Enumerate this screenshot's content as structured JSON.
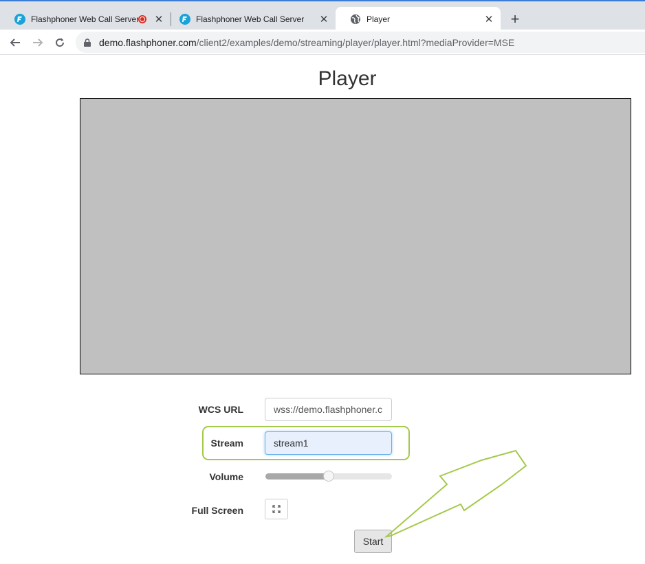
{
  "browser": {
    "tabs": [
      {
        "label": "Flashphoner Web Call Server",
        "favicon": "flashphoner-icon",
        "recording": true
      },
      {
        "label": "Flashphoner Web Call Server",
        "favicon": "flashphoner-icon"
      },
      {
        "label": "Player",
        "favicon": "globe-icon",
        "active": true
      }
    ],
    "new_tab": "+",
    "address": {
      "host": "demo.flashphoner.com",
      "path": "/client2/examples/demo/streaming/player/player.html?mediaProvider=MSE"
    }
  },
  "page": {
    "title": "Player",
    "form": {
      "wcs_url_label": "WCS URL",
      "wcs_url_value": "wss://demo.flashphoner.c",
      "stream_label": "Stream",
      "stream_value": "stream1",
      "volume_label": "Volume",
      "volume_percent": 50,
      "fullscreen_label": "Full Screen",
      "start_label": "Start"
    }
  },
  "colors": {
    "accent_highlight": "#a4c94b",
    "video_bg": "#c0c0c0",
    "recording": "#d93025",
    "flashphoner_brand": "#1aa3d9"
  }
}
